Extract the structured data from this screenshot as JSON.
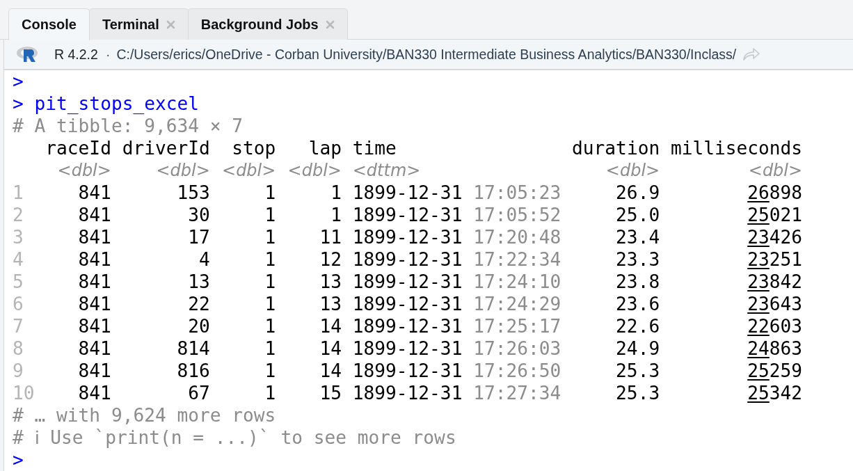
{
  "tabs": [
    {
      "label": "Console",
      "selected": true,
      "closable": false
    },
    {
      "label": "Terminal",
      "selected": false,
      "closable": true
    },
    {
      "label": "Background Jobs",
      "selected": false,
      "closable": true
    }
  ],
  "path_bar": {
    "version": "R 4.2.2",
    "separator": "·",
    "path": "C:/Users/erics/OneDrive - Corban University/BAN330 Intermediate Business Analytics/BAN330/Inclass/"
  },
  "console": {
    "lines_before": [
      {
        "kind": "prompt",
        "prompt": ">"
      },
      {
        "kind": "command",
        "prompt": ">",
        "text": "pit_stops_excel"
      },
      {
        "kind": "comment",
        "text": "# A tibble: 9,634 × 7"
      }
    ],
    "table": {
      "columns": [
        {
          "name": "raceId",
          "type": "<dbl>",
          "kind": "num"
        },
        {
          "name": "driverId",
          "type": "<dbl>",
          "kind": "num"
        },
        {
          "name": "stop",
          "type": "<dbl>",
          "kind": "num"
        },
        {
          "name": "lap",
          "type": "<dbl>",
          "kind": "num"
        },
        {
          "name": "time",
          "type": "<dttm>",
          "kind": "datetime"
        },
        {
          "name": "duration",
          "type": "<dbl>",
          "kind": "num"
        },
        {
          "name": "milliseconds",
          "type": "<dbl>",
          "kind": "grouped"
        }
      ],
      "rows": [
        {
          "index": "1",
          "cells": [
            "841",
            "153",
            "1",
            "1",
            {
              "date": "1899-12-31",
              "clock": "17:05:23"
            },
            "26.9",
            "26898"
          ]
        },
        {
          "index": "2",
          "cells": [
            "841",
            "30",
            "1",
            "1",
            {
              "date": "1899-12-31",
              "clock": "17:05:52"
            },
            "25.0",
            "25021"
          ]
        },
        {
          "index": "3",
          "cells": [
            "841",
            "17",
            "1",
            "11",
            {
              "date": "1899-12-31",
              "clock": "17:20:48"
            },
            "23.4",
            "23426"
          ]
        },
        {
          "index": "4",
          "cells": [
            "841",
            "4",
            "1",
            "12",
            {
              "date": "1899-12-31",
              "clock": "17:22:34"
            },
            "23.3",
            "23251"
          ]
        },
        {
          "index": "5",
          "cells": [
            "841",
            "13",
            "1",
            "13",
            {
              "date": "1899-12-31",
              "clock": "17:24:10"
            },
            "23.8",
            "23842"
          ]
        },
        {
          "index": "6",
          "cells": [
            "841",
            "22",
            "1",
            "13",
            {
              "date": "1899-12-31",
              "clock": "17:24:29"
            },
            "23.6",
            "23643"
          ]
        },
        {
          "index": "7",
          "cells": [
            "841",
            "20",
            "1",
            "14",
            {
              "date": "1899-12-31",
              "clock": "17:25:17"
            },
            "22.6",
            "22603"
          ]
        },
        {
          "index": "8",
          "cells": [
            "841",
            "814",
            "1",
            "14",
            {
              "date": "1899-12-31",
              "clock": "17:26:03"
            },
            "24.9",
            "24863"
          ]
        },
        {
          "index": "9",
          "cells": [
            "841",
            "816",
            "1",
            "14",
            {
              "date": "1899-12-31",
              "clock": "17:26:50"
            },
            "25.3",
            "25259"
          ]
        },
        {
          "index": "10",
          "cells": [
            "841",
            "67",
            "1",
            "15",
            {
              "date": "1899-12-31",
              "clock": "17:27:34"
            },
            "25.3",
            "25342"
          ]
        }
      ]
    },
    "lines_after": [
      {
        "kind": "comment",
        "text": "# … with 9,624 more rows"
      },
      {
        "kind": "comment",
        "text": "# ℹ Use `print(n = ...)` to see more rows"
      },
      {
        "kind": "prompt",
        "prompt": ">"
      }
    ]
  }
}
